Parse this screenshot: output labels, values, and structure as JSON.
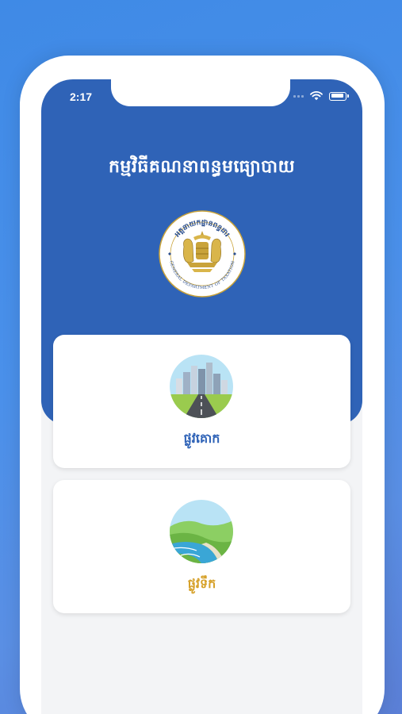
{
  "status_bar": {
    "time": "2:17"
  },
  "header": {
    "title": "កម្មវិធីគណនាពន្ធមធ្យោបាយ",
    "emblem": {
      "top_text": "អគ្គនាយកដ្ឋានពន្ធដារ",
      "bottom_text": "GENERAL DEPARTMENT OF TAXATION"
    }
  },
  "cards": [
    {
      "label": "ផ្លូវគោក",
      "icon": "land-road-icon",
      "accent": "#2f63b7"
    },
    {
      "label": "ផ្លូវទឹក",
      "icon": "waterway-icon",
      "accent": "#d6a12a"
    }
  ],
  "colors": {
    "header_blue": "#2f63b7",
    "background_blue": "#4a90ea",
    "gold": "#d6a12a",
    "screen_bg": "#f3f4f6"
  }
}
